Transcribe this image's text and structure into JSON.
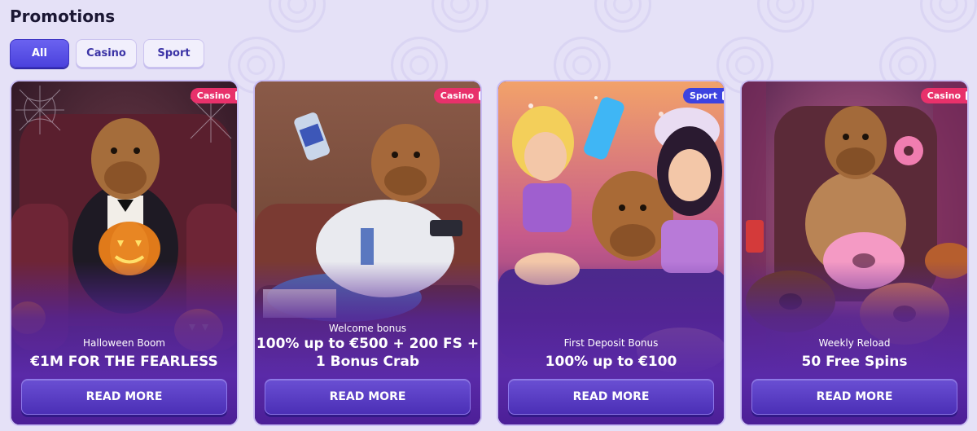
{
  "page": {
    "title": "Promotions"
  },
  "filters": [
    {
      "label": "All",
      "active": true
    },
    {
      "label": "Casino",
      "active": false
    },
    {
      "label": "Sport",
      "active": false
    }
  ],
  "cards": [
    {
      "badge": "Casino",
      "subtitle": "Halloween Boom",
      "title": "€1M FOR THE FEARLESS",
      "button": "READ MORE"
    },
    {
      "badge": "Casino",
      "subtitle": "Welcome bonus",
      "title_line1": "100% up to €500 + 200 FS +",
      "title_line2": "1 Bonus Crab",
      "button": "READ MORE"
    },
    {
      "badge": "Sport",
      "subtitle": "First Deposit Bonus",
      "title": "100% up to €100",
      "button": "READ MORE"
    },
    {
      "badge": "Casino",
      "subtitle": "Weekly Reload",
      "title": "50 Free Spins",
      "button": "READ MORE"
    }
  ],
  "colors": {
    "background": "#e5e1f7",
    "accent": "#4b42dd",
    "casino_badge": "#e8316b",
    "sport_badge": "#3d43e0",
    "button": "#4b2fb6"
  }
}
